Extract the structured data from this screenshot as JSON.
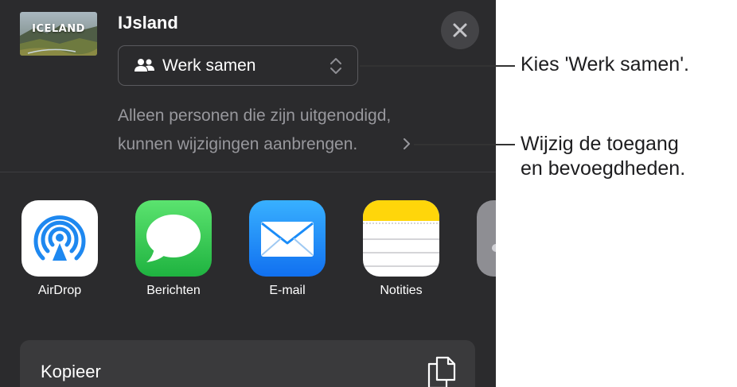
{
  "document": {
    "title": "IJsland",
    "thumbnail_text": "ICELAND"
  },
  "collaboration": {
    "mode_label": "Werk samen"
  },
  "access": {
    "line1": "Alleen personen die zijn uitgenodigd,",
    "line2": "kunnen wijzigingen aanbrengen."
  },
  "apps": [
    {
      "label": "AirDrop",
      "icon": "airdrop-icon"
    },
    {
      "label": "Berichten",
      "icon": "messages-icon"
    },
    {
      "label": "E-mail",
      "icon": "mail-icon"
    },
    {
      "label": "Notities",
      "icon": "notes-icon"
    }
  ],
  "actions": {
    "copy_label": "Kopieer"
  },
  "callouts": {
    "collab": "Kies 'Werk samen'.",
    "access_line1": "Wijzig de toegang",
    "access_line2": "en bevoegdheden."
  },
  "colors": {
    "sheet_background": "#2b2b2d",
    "secondary_text": "#98989d",
    "airdrop_blue": "#1e88f0",
    "messages_green": "#34c759",
    "mail_blue": "#1a8cf8",
    "notes_yellow": "#ffd60a"
  }
}
